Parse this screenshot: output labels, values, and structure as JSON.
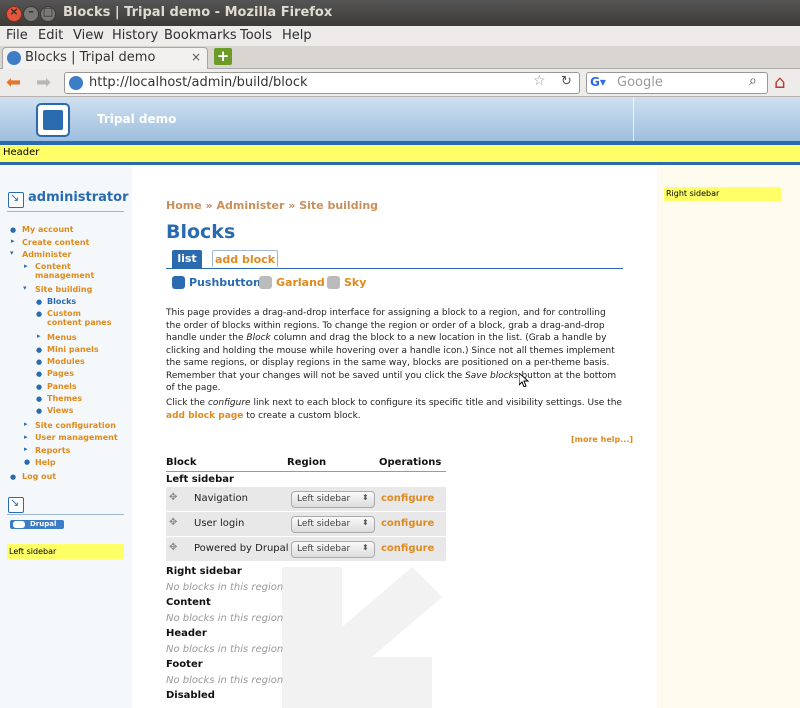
{
  "window": {
    "title": "Blocks | Tripal demo - Mozilla Firefox"
  },
  "menu": [
    "File",
    "Edit",
    "View",
    "History",
    "Bookmarks",
    "Tools",
    "Help"
  ],
  "browser": {
    "tab_title": "Blocks | Tripal demo",
    "url": "http://localhost/admin/build/block",
    "search_placeholder": "Google"
  },
  "site": {
    "name": "Tripal demo"
  },
  "regions": {
    "header": "Header",
    "left_sidebar": "Left sidebar",
    "right_sidebar": "Right sidebar"
  },
  "user_block": {
    "title": "administrator",
    "items": [
      {
        "label": "My account"
      },
      {
        "label": "Create content"
      },
      {
        "label": "Administer"
      },
      {
        "label": "Content management"
      },
      {
        "label": "Site building"
      },
      {
        "label": "Blocks"
      },
      {
        "label": "Custom content panes"
      },
      {
        "label": "Menus"
      },
      {
        "label": "Mini panels"
      },
      {
        "label": "Modules"
      },
      {
        "label": "Pages"
      },
      {
        "label": "Panels"
      },
      {
        "label": "Themes"
      },
      {
        "label": "Views"
      },
      {
        "label": "Site configuration"
      },
      {
        "label": "User management"
      },
      {
        "label": "Reports"
      },
      {
        "label": "Help"
      },
      {
        "label": "Log out"
      }
    ]
  },
  "powered_badge": "Drupal",
  "breadcrumb": [
    "Home",
    "Administer",
    "Site building"
  ],
  "breadcrumb_sep": "»",
  "page_title": "Blocks",
  "tabs": {
    "list": "list",
    "add_block": "add block"
  },
  "subtabs": [
    "Pushbutton",
    "Garland",
    "Sky"
  ],
  "intro": {
    "p1_a": "This page provides a drag-and-drop interface for assigning a block to a region, and for controlling the order of blocks within regions. To change the region or order of a block, grab a drag-and-drop handle under the ",
    "p1_block": "Block",
    "p1_b": " column and drag the block to a new location in the list. (Grab a handle by clicking and holding the mouse while hovering over a handle icon.) Since not all themes implement the same regions, or display regions in the same way, blocks are positioned on a per-theme basis. Remember that your changes will not be saved until you click the ",
    "p1_save": "Save blocks",
    "p1_c": " button at the bottom of the page.",
    "p2_a": "Click the ",
    "p2_configure": "configure",
    "p2_b": " link next to each block to configure its specific title and visibility settings. Use the ",
    "p2_link": "add block page",
    "p2_c": " to create a custom block."
  },
  "more_help": "[more help...]",
  "table": {
    "headers": {
      "block": "Block",
      "region": "Region",
      "operations": "Operations"
    },
    "groups": [
      {
        "region": "Left sidebar",
        "rows": [
          {
            "block": "Navigation",
            "region": "Left sidebar",
            "op": "configure"
          },
          {
            "block": "User login",
            "region": "Left sidebar",
            "op": "configure"
          },
          {
            "block": "Powered by Drupal",
            "region": "Left sidebar",
            "op": "configure"
          }
        ]
      },
      {
        "region": "Right sidebar",
        "empty": "No blocks in this region"
      },
      {
        "region": "Content",
        "empty": "No blocks in this region"
      },
      {
        "region": "Header",
        "empty": "No blocks in this region"
      },
      {
        "region": "Footer",
        "empty": "No blocks in this region"
      },
      {
        "region": "Disabled"
      }
    ]
  },
  "colors": {
    "accent_blue": "#2a6bb0",
    "link_orange": "#e08a1e",
    "region_yellow": "#ffff66"
  }
}
